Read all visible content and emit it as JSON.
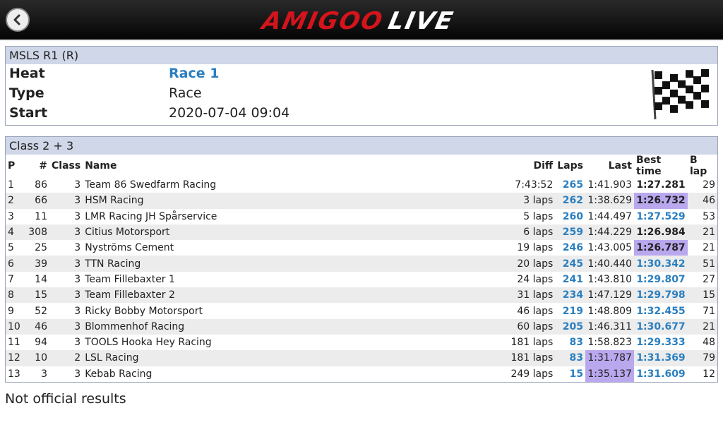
{
  "header": {
    "logo_part1": "AMIGOO",
    "logo_part2": "LIVE"
  },
  "event": {
    "title": "MSLS R1 (R)",
    "heat_label": "Heat",
    "heat_value": "Race 1",
    "type_label": "Type",
    "type_value": "Race",
    "start_label": "Start",
    "start_value": "2020-07-04 09:04"
  },
  "results": {
    "class_title": "Class 2 + 3",
    "columns": [
      "P",
      "#",
      "Class",
      "Name",
      "Diff",
      "Laps",
      "Last",
      "Best time",
      "B lap"
    ],
    "rows": [
      {
        "p": "1",
        "num": "86",
        "cls": "3",
        "name": "Team 86 Swedfarm Racing",
        "diff": "7:43:52",
        "laps": "265",
        "last": "1:41.903",
        "best": "1:27.281",
        "blap": "29",
        "best_dark": true,
        "best_hl": false,
        "last_hl": false
      },
      {
        "p": "2",
        "num": "66",
        "cls": "3",
        "name": "HSM Racing",
        "diff": "3 laps",
        "laps": "262",
        "last": "1:38.629",
        "best": "1:26.732",
        "blap": "46",
        "best_dark": true,
        "best_hl": true,
        "last_hl": false
      },
      {
        "p": "3",
        "num": "11",
        "cls": "3",
        "name": "LMR Racing JH Spårservice",
        "diff": "5 laps",
        "laps": "260",
        "last": "1:44.497",
        "best": "1:27.529",
        "blap": "53",
        "best_dark": false,
        "best_hl": false,
        "last_hl": false
      },
      {
        "p": "4",
        "num": "308",
        "cls": "3",
        "name": "Citius Motorsport",
        "diff": "6 laps",
        "laps": "259",
        "last": "1:44.229",
        "best": "1:26.984",
        "blap": "21",
        "best_dark": true,
        "best_hl": false,
        "last_hl": false
      },
      {
        "p": "5",
        "num": "25",
        "cls": "3",
        "name": "Nyströms Cement",
        "diff": "19 laps",
        "laps": "246",
        "last": "1:43.005",
        "best": "1:26.787",
        "blap": "21",
        "best_dark": true,
        "best_hl": true,
        "last_hl": false
      },
      {
        "p": "6",
        "num": "39",
        "cls": "3",
        "name": "TTN Racing",
        "diff": "20 laps",
        "laps": "245",
        "last": "1:40.440",
        "best": "1:30.342",
        "blap": "51",
        "best_dark": false,
        "best_hl": false,
        "last_hl": false
      },
      {
        "p": "7",
        "num": "14",
        "cls": "3",
        "name": "Team Fillebaxter 1",
        "diff": "24 laps",
        "laps": "241",
        "last": "1:43.810",
        "best": "1:29.807",
        "blap": "27",
        "best_dark": false,
        "best_hl": false,
        "last_hl": false
      },
      {
        "p": "8",
        "num": "15",
        "cls": "3",
        "name": "Team Fillebaxter 2",
        "diff": "31 laps",
        "laps": "234",
        "last": "1:47.129",
        "best": "1:29.798",
        "blap": "15",
        "best_dark": false,
        "best_hl": false,
        "last_hl": false
      },
      {
        "p": "9",
        "num": "52",
        "cls": "3",
        "name": "Ricky Bobby Motorsport",
        "diff": "46 laps",
        "laps": "219",
        "last": "1:48.809",
        "best": "1:32.455",
        "blap": "71",
        "best_dark": false,
        "best_hl": false,
        "last_hl": false
      },
      {
        "p": "10",
        "num": "46",
        "cls": "3",
        "name": "Blommenhof Racing",
        "diff": "60 laps",
        "laps": "205",
        "last": "1:46.311",
        "best": "1:30.677",
        "blap": "21",
        "best_dark": false,
        "best_hl": false,
        "last_hl": false
      },
      {
        "p": "11",
        "num": "94",
        "cls": "3",
        "name": "TOOLS Hooka Hey Racing",
        "diff": "181 laps",
        "laps": "83",
        "last": "1:58.823",
        "best": "1:29.333",
        "blap": "48",
        "best_dark": false,
        "best_hl": false,
        "last_hl": false
      },
      {
        "p": "12",
        "num": "10",
        "cls": "2",
        "name": "LSL Racing",
        "diff": "181 laps",
        "laps": "83",
        "last": "1:31.787",
        "best": "1:31.369",
        "blap": "79",
        "best_dark": false,
        "best_hl": false,
        "last_hl": true
      },
      {
        "p": "13",
        "num": "3",
        "cls": "3",
        "name": "Kebab Racing",
        "diff": "249 laps",
        "laps": "15",
        "last": "1:35.137",
        "best": "1:31.609",
        "blap": "12",
        "best_dark": false,
        "best_hl": false,
        "last_hl": true
      }
    ]
  },
  "footer": {
    "note": "Not official results"
  },
  "colors": {
    "accent_blue": "#2a7fc0",
    "highlight_purple": "#b9a8ee",
    "header_bg": "#cfd7e8",
    "logo_red": "#d4141c"
  },
  "icons": {
    "back": "back-arrow-icon",
    "flag": "checkered-flag-icon"
  }
}
